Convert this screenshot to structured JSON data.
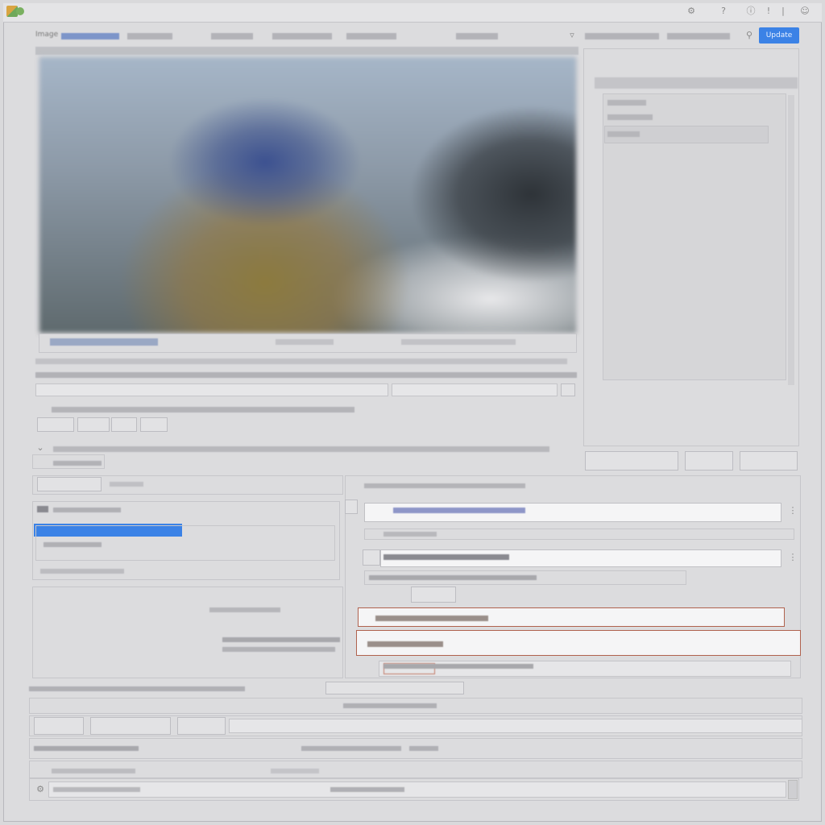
{
  "window": {
    "title_icons": [
      "settings-icon",
      "help-icon",
      "info-icon",
      "alert-icon",
      "user-icon"
    ]
  },
  "toolbar": {
    "items": [
      "Image",
      "",
      "",
      "",
      "",
      "",
      ""
    ],
    "primary_button": "Update"
  },
  "viewer": {
    "caption_left": "",
    "caption_mid": "",
    "caption_right": ""
  },
  "right_panel": {
    "header": "",
    "list_items": [
      "",
      "",
      ""
    ],
    "buttons": [
      "",
      "",
      ""
    ]
  },
  "form": {
    "row1": "",
    "row2": "",
    "row3": "",
    "chips": [
      "",
      "",
      "",
      ""
    ],
    "note": ""
  },
  "lower": {
    "label_a": "",
    "label_b": "",
    "list_header": "",
    "selected_item": "",
    "list_item2": "",
    "list_footer": "",
    "center_label": "",
    "center_text": "",
    "field1": "",
    "field1_sub": "",
    "field2": "",
    "field2_sub": "",
    "field3": "",
    "field4": "",
    "field5": ""
  },
  "bottom": {
    "status_left": "",
    "status_mid": "",
    "bar_title": "",
    "btn1": "",
    "btn2": "",
    "btn3": "",
    "info_left": "",
    "info_mid": "",
    "info_right": "",
    "footer_left": "",
    "footer_mid": "",
    "footer_right": ""
  },
  "colors": {
    "accent": "#3b82e6",
    "highlight_border": "#b0624e",
    "background": "#d9d9db"
  }
}
